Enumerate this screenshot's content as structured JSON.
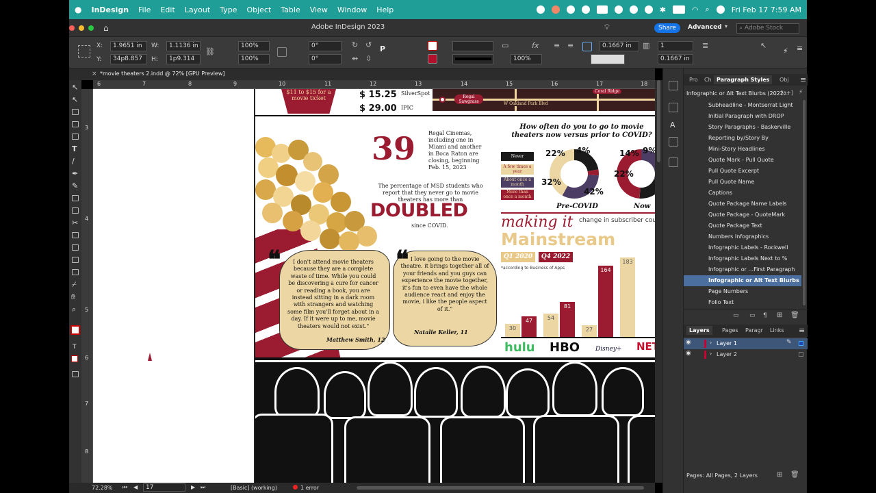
{
  "menubar": {
    "app": "InDesign",
    "items": [
      "File",
      "Edit",
      "Layout",
      "Type",
      "Object",
      "Table",
      "View",
      "Window",
      "Help"
    ],
    "clock": "Fri Feb 17  7:59 AM"
  },
  "titlebar": {
    "title": "Adobe InDesign 2023",
    "share": "Share",
    "workspace": "Advanced",
    "search_placeholder": "Adobe Stock"
  },
  "control": {
    "x": "1.9651 in",
    "y": "34p8.857",
    "w": "1.1136 in",
    "h": "1p9.314",
    "scale_x": "100%",
    "scale_y": "100%",
    "rotate": "0°",
    "shear": "0°",
    "opacity": "100%",
    "stroke_w": "0.1667 in",
    "stroke_w2": "0.1667 in",
    "cols": "1"
  },
  "doc_tab": "*movie theaters 2.indd @ 72% [GPU Preview]",
  "ruler_top": [
    "6",
    "7",
    "8",
    "9",
    "10",
    "11",
    "12",
    "13",
    "14",
    "15",
    "16",
    "17",
    "18"
  ],
  "ruler_left": [
    "3",
    "4",
    "5",
    "6",
    "7",
    "8"
  ],
  "layout": {
    "price1": "$ 15.25",
    "price1_label": "SilverSpot",
    "price2": "$ 29.00",
    "price2_label": "IPIC",
    "ticket": "$11 to $15 for a movie ticket",
    "map_labels": [
      "Regal Sawgrass",
      "W Oakland Park Blvd",
      "Coral Ridge"
    ],
    "big_number": "39",
    "regal_blurb": "Regal Cinemas, including one in Miami and another in Boca Raton are closing, beginning Feb. 15, 2023",
    "msd_blurb": "The percentage of MSD students who report that they never go to movie theaters has more than",
    "doubled": "DOUBLED",
    "since": "since COVID.",
    "survey_title": "How often do you to go to movie theaters now versus prior to COVID?",
    "legend": [
      "Never",
      "A few times a year",
      "About once a month",
      "More than once a month"
    ],
    "pre_covid_label": "Pre-COVID",
    "now_label": "Now",
    "pre_covid_pcts": [
      "22%",
      "4%",
      "32%",
      "42%"
    ],
    "now_pcts": [
      "14%",
      "9%",
      "22%"
    ],
    "quote1": "I don't attend movie theaters because they are a complete waste of time. While you could be discovering a cure for cancer or reading a book, you are instead sitting in a dark room with strangers and watching some film you'll forget about in a day. If it were up to me, movie theaters would not exist.\"",
    "quote1_author": "Matthew Smith, 12",
    "quote2": "I love going to the movie theatre. it brings together all of your friends and you guys can experience the movie together, it's fun to even have the whole audience react and enjoy the movie, i like the people aspect of it.\"",
    "quote2_author": "Natalie Keller, 11",
    "making_it": "making it",
    "mainstream": "Mainstream",
    "subscriber_blurb": "change in subscriber count in millions by streaming service",
    "q1": "Q1 2020",
    "q4": "Q4 2022",
    "according": "*according to Business of Apps",
    "brands": [
      "hulu",
      "HBO",
      "Disney+",
      "NETFLIX"
    ]
  },
  "chart_data": [
    {
      "type": "bar",
      "title": "making it Mainstream",
      "categories": [
        "hulu",
        "HBO",
        "Disney+",
        "NETFLIX"
      ],
      "series": [
        {
          "name": "Q1 2020",
          "values": [
            30,
            54,
            27,
            183
          ]
        },
        {
          "name": "Q4 2022",
          "values": [
            47,
            81,
            164,
            null
          ]
        }
      ]
    },
    {
      "type": "pie",
      "title": "Pre-COVID",
      "labels": [
        "22%",
        "4%",
        "32%",
        "42%"
      ],
      "values": [
        22,
        4,
        32,
        42
      ]
    },
    {
      "type": "pie",
      "title": "Now",
      "labels": [
        "14%",
        "9%",
        "22%"
      ],
      "values": [
        14,
        9,
        22
      ]
    }
  ],
  "panel": {
    "tabs": [
      "Pro",
      "Ch",
      "Paragraph Styles",
      "Obj"
    ],
    "group": "Infographic or Alt Text Blurbs (2022...",
    "styles": [
      "Subheadline - Montserrat Light",
      "Initial Paragraph with DROP",
      "Story Paragraphs - Baskerville",
      "Reporting by/Story By",
      "Mini-Story Headlines",
      "Quote Mark - Pull Quote",
      "Pull Quote Excerpt",
      "Pull Quote Name",
      "Captions",
      "Quote Package Name Labels",
      "Quote Package - QuoteMark",
      "Quote Package Text",
      "Numbers Infographics",
      "Infographic Labels - Rockwell",
      "Infographic Labels Next to %",
      "Infographic or ...First Paragraph",
      "Infographic or Alt Text Blurbs",
      "Page Numbers",
      "Folio Text"
    ],
    "selected_index": 16,
    "layer_tabs": [
      "Layers",
      "Pages",
      "Paragr",
      "Links"
    ],
    "layers": [
      "Layer 1",
      "Layer 2"
    ],
    "layers_status": "Pages: All Pages, 2 Layers"
  },
  "status": {
    "zoom": "72.28%",
    "page": "17",
    "style": "[Basic] (working)",
    "errors": "1 error"
  }
}
